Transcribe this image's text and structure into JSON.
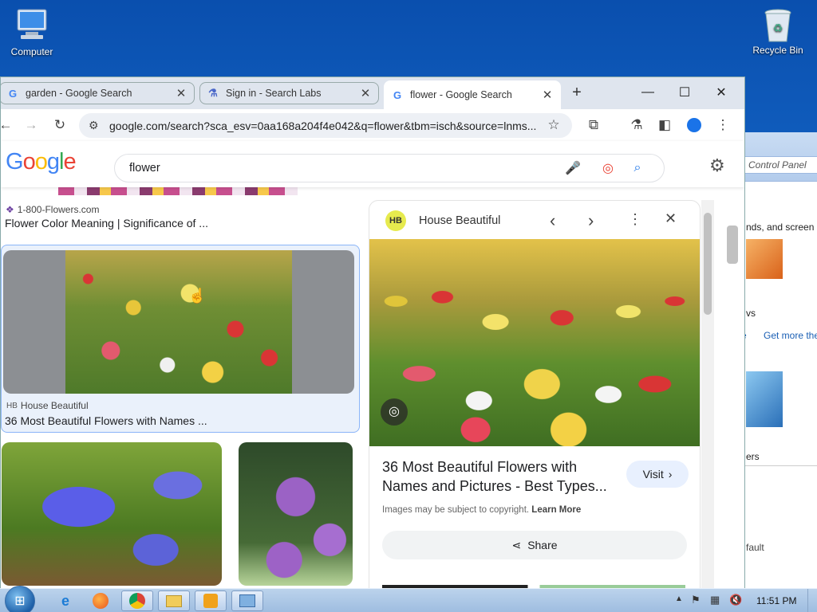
{
  "desktop": {
    "icons": [
      {
        "label": "Computer"
      },
      {
        "label": "Recycle Bin"
      }
    ]
  },
  "control_panel": {
    "address": "Control Panel",
    "snippets": [
      "nds, and screen s",
      "vs",
      "e",
      "Get more the",
      "ers",
      "fault"
    ]
  },
  "browser": {
    "tabs": [
      {
        "label": "garden - Google Search",
        "favicon": "G"
      },
      {
        "label": "Sign in - Search Labs",
        "favicon": "flask"
      },
      {
        "label": "flower - Google Search",
        "favicon": "G"
      }
    ],
    "new_tab": "+",
    "url": "google.com/search?sca_esv=0aa168a204f4e042&q=flower&tbm=isch&source=lnms..."
  },
  "google": {
    "logo": "Google",
    "query": "flower"
  },
  "results": {
    "item1": {
      "source": "1-800-Flowers.com",
      "title": "Flower Color Meaning | Significance of ..."
    },
    "item2": {
      "source": "House Beautiful",
      "title": "36 Most Beautiful Flowers with Names ..."
    }
  },
  "preview": {
    "badge": "HB",
    "site": "House Beautiful",
    "title_line1": "36 Most Beautiful Flowers with",
    "title_line2": "Names and Pictures - Best Types...",
    "visit": "Visit",
    "copyright": "Images may be subject to copyright.",
    "learn_more": "Learn More",
    "share": "Share"
  },
  "taskbar": {
    "clock": "11:51 PM"
  }
}
